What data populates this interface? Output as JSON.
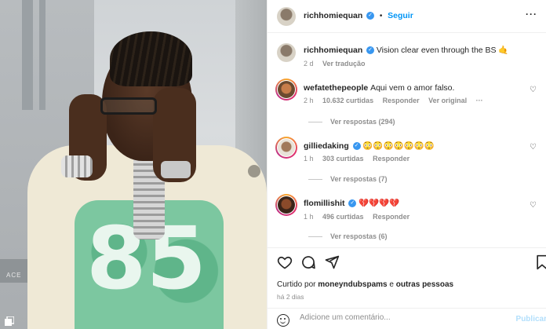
{
  "post_author": {
    "username": "richhomiequan",
    "follow_label": "Seguir",
    "separator": "•",
    "more": "···"
  },
  "caption": {
    "username": "richhomiequan",
    "text": "Vision clear even through the BS",
    "emoji": "🤙",
    "time": "2 d",
    "translate": "Ver tradução"
  },
  "comments": [
    {
      "username": "wefatethepeople",
      "text": "Aqui vem o amor falso.",
      "time": "2 h",
      "likes": "10.632 curtidas",
      "reply": "Responder",
      "original": "Ver original",
      "more": "···",
      "replies": "Ver respostas (294)"
    },
    {
      "username": "gilliedaking",
      "text": "😳😳😳😳😳😳😳",
      "time": "1 h",
      "likes": "303 curtidas",
      "reply": "Responder",
      "replies": "Ver respostas (7)"
    },
    {
      "username": "flomillishit",
      "text": "💔💔💔💔",
      "time": "1 h",
      "likes": "496 curtidas",
      "reply": "Responder",
      "replies": "Ver respostas (6)"
    }
  ],
  "likes_line": {
    "prefix": "Curtido por",
    "user": "moneyndubspams",
    "conj": "e",
    "others": "outras pessoas"
  },
  "date": "há 2 dias",
  "comment_box": {
    "placeholder": "Adicione um comentário...",
    "publish": "Publicar"
  },
  "photo": {
    "jersey_number": "85",
    "shelf_text": "ACE"
  },
  "colors": {
    "accent": "#0095f6",
    "verified": "#3897f0",
    "jersey_green": "#7cc7a0"
  }
}
